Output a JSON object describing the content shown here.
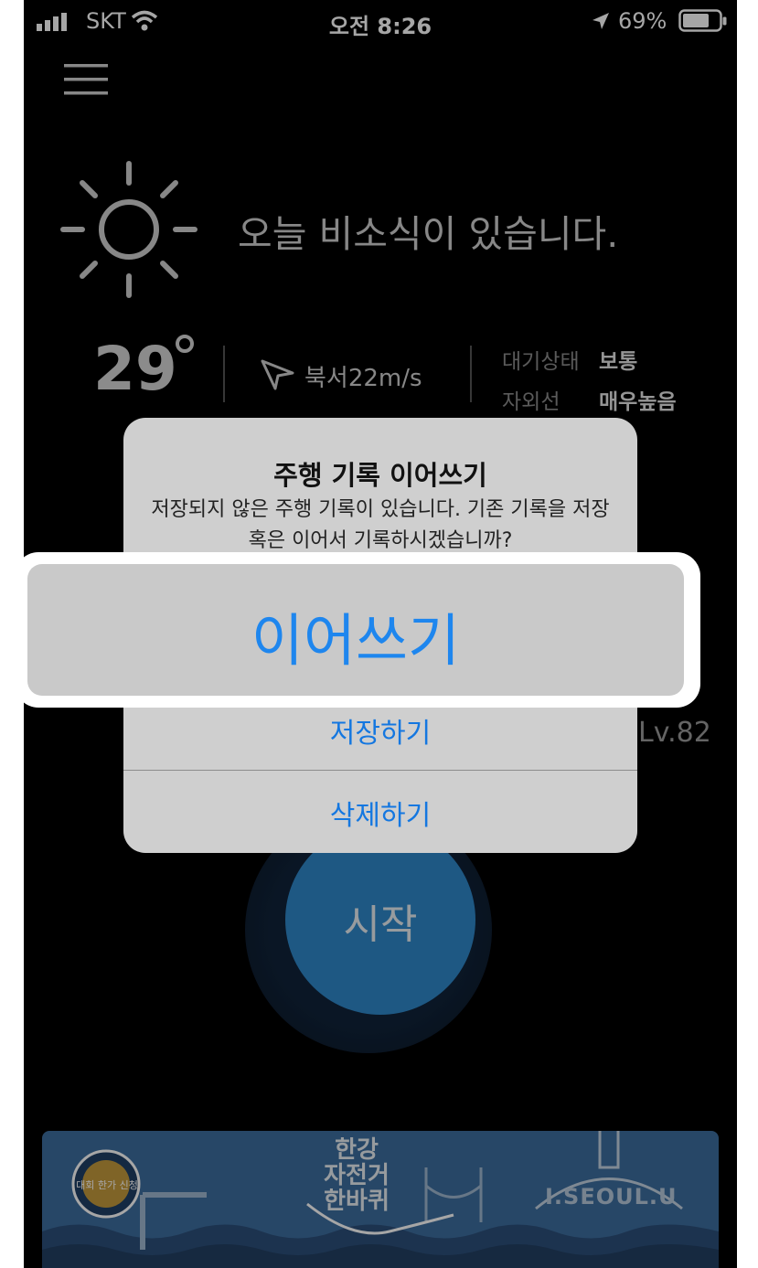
{
  "status_bar": {
    "carrier": "SKT",
    "time": "오전 8:26",
    "battery": "69%"
  },
  "weather": {
    "headline": "오늘 비소식이 있습니다.",
    "temperature": "29",
    "wind": "북서22m/s",
    "air_label": "대기상태",
    "air_value": "보통",
    "uv_label": "자외선",
    "uv_value": "매우높음",
    "icon": "sun-icon"
  },
  "level_text": "Lv.82",
  "start_button": {
    "label": "시작"
  },
  "banner": {
    "badge": "대회 한가 신청",
    "title_lines": [
      "한강",
      "자전거",
      "한바퀴"
    ],
    "brand": "I.SEOUL.U"
  },
  "alert": {
    "title": "주행 기록 이어쓰기",
    "message": "저장되지 않은 주행 기록이 있습니다. 기존 기록을 저장 혹은 이어서 기록하시겠습니까?",
    "buttons": {
      "continue": "이어쓰기",
      "save": "저장하기",
      "delete": "삭제하기"
    }
  },
  "colors": {
    "accent": "#1477e0",
    "start_button": "#2f87c9",
    "background": "#000000",
    "alert_bg": "#cfcfcf"
  }
}
